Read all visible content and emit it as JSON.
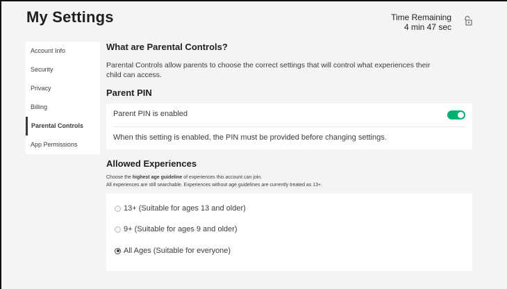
{
  "header": {
    "title": "My Settings",
    "time_remaining_label": "Time Remaining",
    "time_remaining_value": "4 min 47 sec",
    "lock_icon": "lock-icon"
  },
  "sidebar": {
    "items": [
      {
        "label": "Account Info",
        "active": false
      },
      {
        "label": "Security",
        "active": false
      },
      {
        "label": "Privacy",
        "active": false
      },
      {
        "label": "Billing",
        "active": false
      },
      {
        "label": "Parental Controls",
        "active": true
      },
      {
        "label": "App Permissions",
        "active": false
      }
    ]
  },
  "parental": {
    "heading": "What are Parental Controls?",
    "description": "Parental Controls allow parents to choose the correct settings that will control what experiences their child can access."
  },
  "pin": {
    "heading": "Parent PIN",
    "toggle_label": "Parent PIN is enabled",
    "enabled": true,
    "note": "When this setting is enabled, the PIN must be provided before changing settings.",
    "accent_color": "#00b06f"
  },
  "experiences": {
    "heading": "Allowed Experiences",
    "line1_prefix": "Choose the ",
    "line1_bold": "highest age guideline",
    "line1_suffix": " of experiences this account can join.",
    "line2": "All experiences are still searchable. Experiences without age guidelines are currently treated as 13+.",
    "options": [
      {
        "label": "13+ (Suitable for ages 13 and older)",
        "selected": false
      },
      {
        "label": "9+ (Suitable for ages 9 and older)",
        "selected": false
      },
      {
        "label": "All Ages (Suitable for everyone)",
        "selected": true
      }
    ]
  }
}
